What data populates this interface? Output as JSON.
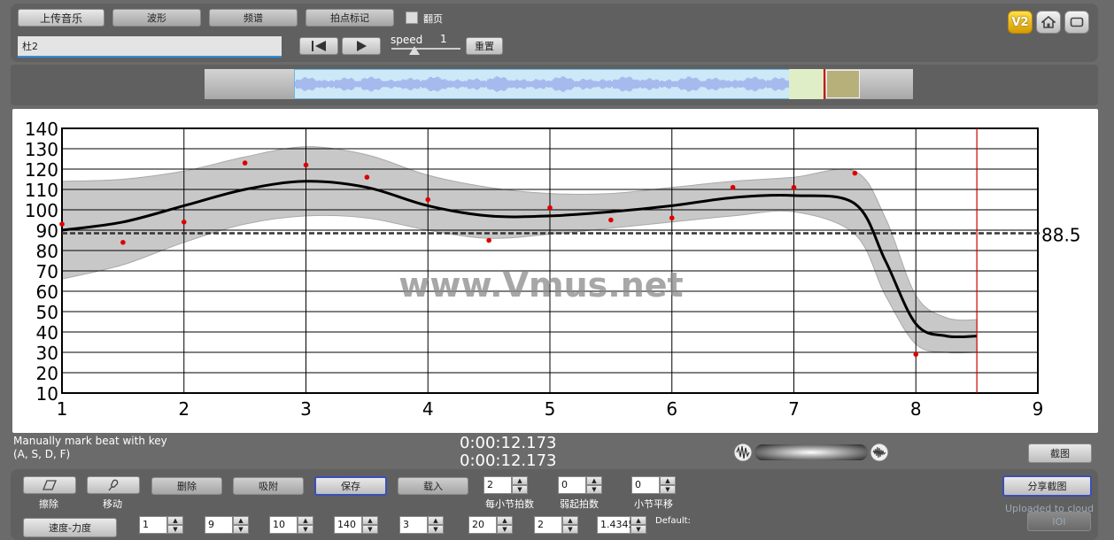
{
  "toolbar": {
    "upload_label": "上传音乐",
    "waveform_label": "波形",
    "spectrum_label": "频谱",
    "beat_mark_label": "拍点标记",
    "flip_label": "翻页",
    "song_title": "杜2",
    "speed_label": "speed",
    "speed_value": "1",
    "reset_label": "重置",
    "version_badge": "V2"
  },
  "icons": {
    "prev": "skip-back-icon",
    "play": "play-icon",
    "home": "home-icon",
    "window": "window-icon"
  },
  "chart_data": {
    "type": "line",
    "xlim": [
      1,
      9
    ],
    "ylim": [
      10,
      140
    ],
    "x_ticks": [
      "1",
      "2",
      "3",
      "4",
      "5",
      "6",
      "7",
      "8",
      "9"
    ],
    "y_ticks": [
      "10",
      "20",
      "30",
      "40",
      "50",
      "60",
      "70",
      "80",
      "90",
      "100",
      "110",
      "120",
      "130",
      "140"
    ],
    "grid": true,
    "reference_line": {
      "value": 88.5,
      "label": "88.5"
    },
    "cursor_x": 8.5,
    "points": [
      {
        "x": 1.0,
        "y": 93
      },
      {
        "x": 1.5,
        "y": 84
      },
      {
        "x": 2.0,
        "y": 94
      },
      {
        "x": 2.5,
        "y": 123
      },
      {
        "x": 3.0,
        "y": 122
      },
      {
        "x": 3.5,
        "y": 116
      },
      {
        "x": 4.0,
        "y": 105
      },
      {
        "x": 4.5,
        "y": 85
      },
      {
        "x": 5.0,
        "y": 101
      },
      {
        "x": 5.5,
        "y": 95
      },
      {
        "x": 6.0,
        "y": 96
      },
      {
        "x": 6.5,
        "y": 111
      },
      {
        "x": 7.0,
        "y": 111
      },
      {
        "x": 7.5,
        "y": 118
      },
      {
        "x": 8.0,
        "y": 29
      }
    ],
    "trend": [
      {
        "x": 1.0,
        "y": 90
      },
      {
        "x": 1.5,
        "y": 94
      },
      {
        "x": 2.0,
        "y": 102
      },
      {
        "x": 2.5,
        "y": 110
      },
      {
        "x": 3.0,
        "y": 114
      },
      {
        "x": 3.5,
        "y": 111
      },
      {
        "x": 4.0,
        "y": 102
      },
      {
        "x": 4.5,
        "y": 97
      },
      {
        "x": 5.0,
        "y": 97
      },
      {
        "x": 5.5,
        "y": 99
      },
      {
        "x": 6.0,
        "y": 102
      },
      {
        "x": 6.5,
        "y": 106
      },
      {
        "x": 7.0,
        "y": 107
      },
      {
        "x": 7.5,
        "y": 103
      },
      {
        "x": 7.75,
        "y": 75
      },
      {
        "x": 8.0,
        "y": 44
      },
      {
        "x": 8.25,
        "y": 38
      },
      {
        "x": 8.5,
        "y": 38
      }
    ],
    "band_upper": [
      {
        "x": 1.0,
        "y": 114
      },
      {
        "x": 1.5,
        "y": 115
      },
      {
        "x": 2.0,
        "y": 119
      },
      {
        "x": 2.5,
        "y": 126
      },
      {
        "x": 3.0,
        "y": 131
      },
      {
        "x": 3.5,
        "y": 127
      },
      {
        "x": 4.0,
        "y": 117
      },
      {
        "x": 4.5,
        "y": 111
      },
      {
        "x": 5.0,
        "y": 108
      },
      {
        "x": 5.5,
        "y": 108
      },
      {
        "x": 6.0,
        "y": 111
      },
      {
        "x": 6.5,
        "y": 114
      },
      {
        "x": 7.0,
        "y": 116
      },
      {
        "x": 7.5,
        "y": 119
      },
      {
        "x": 7.75,
        "y": 96
      },
      {
        "x": 8.0,
        "y": 58
      },
      {
        "x": 8.25,
        "y": 47
      },
      {
        "x": 8.5,
        "y": 46
      }
    ],
    "band_lower": [
      {
        "x": 1.0,
        "y": 66
      },
      {
        "x": 1.5,
        "y": 73
      },
      {
        "x": 2.0,
        "y": 84
      },
      {
        "x": 2.5,
        "y": 93
      },
      {
        "x": 3.0,
        "y": 97
      },
      {
        "x": 3.5,
        "y": 96
      },
      {
        "x": 4.0,
        "y": 90
      },
      {
        "x": 4.5,
        "y": 86
      },
      {
        "x": 5.0,
        "y": 88
      },
      {
        "x": 5.5,
        "y": 91
      },
      {
        "x": 6.0,
        "y": 94
      },
      {
        "x": 6.5,
        "y": 97
      },
      {
        "x": 7.0,
        "y": 99
      },
      {
        "x": 7.5,
        "y": 88
      },
      {
        "x": 7.75,
        "y": 58
      },
      {
        "x": 8.0,
        "y": 34
      },
      {
        "x": 8.25,
        "y": 30
      },
      {
        "x": 8.5,
        "y": 30
      }
    ],
    "watermark": "www.Vmus.net",
    "colors": {
      "trend": "#000000",
      "band": "#c8c8c8",
      "points": "#dd0000",
      "cursor": "#cc0000"
    }
  },
  "status": {
    "hint_line1": "Manually mark beat with key",
    "hint_line2": "(A, S, D, F)",
    "time_primary": "0:00:12.173",
    "time_secondary": "0:00:12.173",
    "screenshot_label": "截图"
  },
  "bottom": {
    "erase_label": "擦除",
    "move_label": "移动",
    "delete_label": "删除",
    "snap_label": "吸附",
    "save_label": "保存",
    "load_label": "载入",
    "beats_per_bar_label": "每小节拍数",
    "beats_per_bar_value": "2",
    "pickup_label": "弱起拍数",
    "pickup_value": "0",
    "bar_shift_label": "小节平移",
    "bar_shift_value": "0",
    "share_label": "分享截图",
    "uploaded_label": "Uploaded to cloud",
    "tempo_label": "速度-力度",
    "row2_values": [
      "1",
      "9",
      "10",
      "140",
      "3",
      "20",
      "2",
      "1.4345"
    ],
    "default_label": "Default:",
    "cloud_btn_label": "IOI"
  }
}
